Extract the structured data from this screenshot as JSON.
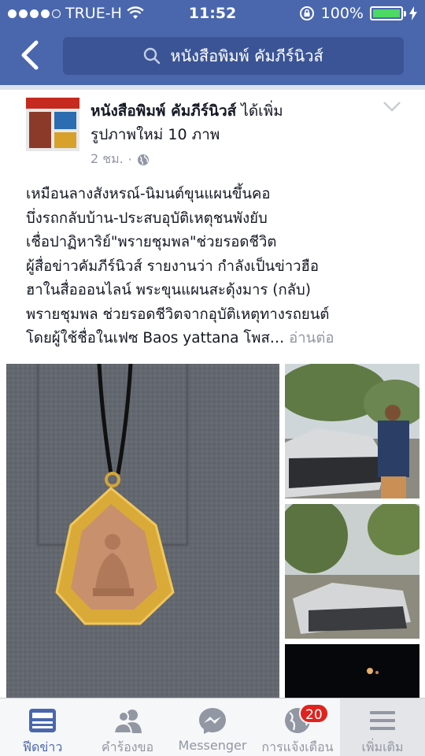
{
  "status_bar": {
    "carrier": "TRUE-H",
    "time": "11:52",
    "battery_percent": "100%",
    "battery_level": 1.0
  },
  "header": {
    "back_icon": "chevron-left-icon",
    "search_text": "หนังสือพิมพ์ คัมภีร์นิวส์"
  },
  "post": {
    "page_name": "หนังสือพิมพ์ คัมภีร์นิวส์",
    "action": " ได้เพิ่ม",
    "action_line2": "รูปภาพใหม่ 10 ภาพ",
    "time": "2 ชม.",
    "separator": "·",
    "privacy_icon": "globe-icon",
    "text_lines": [
      "เหมือนลางสังหรณ์-นิมนต์ขุนแผนขึ้นคอ",
      "บึ่งรถกลับบ้าน-ประสบอุบัติเหตุชนพังยับ",
      "เชื่อปาฏิหาริย์\"พรายชุมพล\"ช่วยรอดชีวิต",
      " ผู้สื่อข่าวคัมภีร์นิวส์ รายงานว่า กำลังเป็นข่าวฮือ",
      "ฮาในสื่อออนไลน์ พระขุนแผนสะดุ้งมาร (กลับ)",
      "พรายชุมพล ช่วยรอดชีวิตจากอุบัติเหตุทางรถยนต์"
    ],
    "last_line": "โดยผู้ใช้ชื่อในเฟซ Baos yattana โพส…",
    "read_more": " อ่านต่อ"
  },
  "tabbar": {
    "items": [
      {
        "label": "ฟีดข่าว",
        "icon": "news-feed-icon",
        "active": true
      },
      {
        "label": "คำร้องขอ",
        "icon": "friend-requests-icon",
        "active": false
      },
      {
        "label": "Messenger",
        "icon": "messenger-icon",
        "active": false
      },
      {
        "label": "การแจ้งเตือน",
        "icon": "notifications-globe-icon",
        "active": false,
        "badge": "20"
      },
      {
        "label": "เพิ่มเติม",
        "icon": "menu-icon",
        "active": false
      }
    ]
  },
  "colors": {
    "brand": "#4a67ad",
    "badge": "#e0231f",
    "battery": "#4cd964"
  }
}
